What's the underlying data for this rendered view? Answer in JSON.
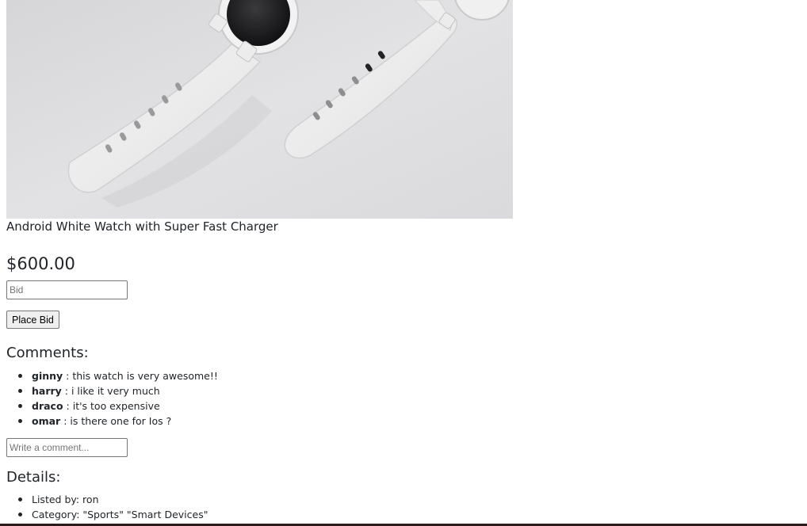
{
  "product": {
    "image_alt": "Android White Watch",
    "title": "Android White Watch with Super Fast Charger",
    "price": "$600.00"
  },
  "bid": {
    "placeholder": "Bid",
    "button_label": "Place Bid"
  },
  "comments": {
    "heading": "Comments:",
    "items": [
      {
        "user": "ginny",
        "separator": " : ",
        "text": "this watch is very awesome!!"
      },
      {
        "user": "harry",
        "separator": " : ",
        "text": "i like it very much"
      },
      {
        "user": "draco",
        "separator": " : ",
        "text": "it's too expensive"
      },
      {
        "user": "omar",
        "separator": " : ",
        "text": "is there one for Ios ?"
      }
    ],
    "input_placeholder": "Write a comment..."
  },
  "details": {
    "heading": "Details:",
    "items": [
      "Listed by: ron",
      "Category: \"Sports\" \"Smart Devices\""
    ]
  },
  "colors": {
    "text": "#212529",
    "image_background": "#e4e4e6"
  }
}
